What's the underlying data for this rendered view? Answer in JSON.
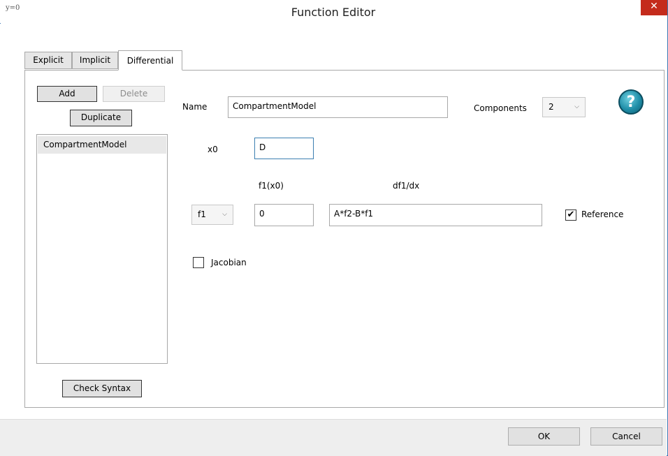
{
  "window": {
    "title": "Function Editor",
    "icon": "function-icon",
    "icon_text": "y=0",
    "close_glyph": "✕"
  },
  "tabs": [
    {
      "label": "Explicit",
      "active": false
    },
    {
      "label": "Implicit",
      "active": false
    },
    {
      "label": "Differential",
      "active": true
    }
  ],
  "left_panel": {
    "add_label": "Add",
    "delete_label": "Delete",
    "duplicate_label": "Duplicate",
    "list_items": [
      "CompartmentModel"
    ],
    "check_syntax_label": "Check Syntax"
  },
  "form": {
    "name_label": "Name",
    "name_value": "CompartmentModel",
    "components_label": "Components",
    "components_value": "2",
    "help_glyph": "?",
    "x0_label": "x0",
    "x0_value": "D",
    "f_init_header": "f1(x0)",
    "f_deriv_header": "df1/dx",
    "function_select": "f1",
    "f_init_value": "0",
    "f_deriv_value": "A*f2-B*f1",
    "reference_label": "Reference",
    "reference_checked": true,
    "jacobian_label": "Jacobian",
    "jacobian_checked": false,
    "check_glyph": "✔"
  },
  "footer": {
    "ok_label": "OK",
    "cancel_label": "Cancel"
  },
  "colors": {
    "accent": "#3c78b4",
    "close": "#c42b1c",
    "help": "#1f8ea8"
  }
}
